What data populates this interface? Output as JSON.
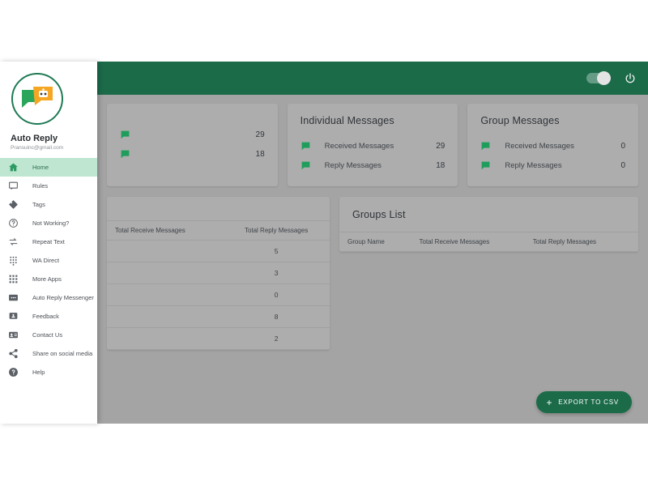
{
  "topbar": {
    "toggle": {
      "name": "service-toggle",
      "state": "on"
    },
    "power_icon": "power-icon"
  },
  "sidebar": {
    "logo_icon": "auto-reply-logo-icon",
    "brand_name": "Auto Reply",
    "account_email": "Pransuinc@gmail.com",
    "items": [
      {
        "label": "Home",
        "icon": "home-icon",
        "active": true
      },
      {
        "label": "Rules",
        "icon": "chat-bubble-icon",
        "active": false
      },
      {
        "label": "Tags",
        "icon": "tag-icon",
        "active": false
      },
      {
        "label": "Not Working?",
        "icon": "help-circle-icon",
        "active": false
      },
      {
        "label": "Repeat Text",
        "icon": "repeat-icon",
        "active": false
      },
      {
        "label": "WA Direct",
        "icon": "dialpad-icon",
        "active": false
      },
      {
        "label": "More Apps",
        "icon": "apps-grid-icon",
        "active": false
      },
      {
        "label": "Auto Reply Messenger",
        "icon": "messenger-icon",
        "active": false
      },
      {
        "label": "Feedback",
        "icon": "feedback-icon",
        "active": false
      },
      {
        "label": "Contact Us",
        "icon": "contact-card-icon",
        "active": false
      },
      {
        "label": "Share on social media",
        "icon": "share-icon",
        "active": false
      },
      {
        "label": "Help",
        "icon": "help-icon",
        "active": false
      }
    ]
  },
  "cards": [
    {
      "title": "",
      "rows": [
        {
          "icon": "message-icon",
          "label": "",
          "value": "29"
        },
        {
          "icon": "message-icon",
          "label": "",
          "value": "18"
        }
      ]
    },
    {
      "title": "Individual Messages",
      "rows": [
        {
          "icon": "message-icon",
          "label": "Received Messages",
          "value": "29"
        },
        {
          "icon": "message-icon",
          "label": "Reply Messages",
          "value": "18"
        }
      ]
    },
    {
      "title": "Group Messages",
      "rows": [
        {
          "icon": "message-icon",
          "label": "Received Messages",
          "value": "0"
        },
        {
          "icon": "message-icon",
          "label": "Reply Messages",
          "value": "0"
        }
      ]
    }
  ],
  "individual_table": {
    "title": "",
    "columns": [
      "Total Receive Messages",
      "Total Reply Messages"
    ],
    "rows": [
      [
        "",
        "5"
      ],
      [
        "",
        "3"
      ],
      [
        "",
        "0"
      ],
      [
        "",
        "8"
      ],
      [
        "",
        "2"
      ]
    ]
  },
  "groups_table": {
    "title": "Groups List",
    "columns": [
      "Group Name",
      "Total Receive Messages",
      "Total Reply Messages"
    ],
    "rows": []
  },
  "export_button": {
    "label": "EXPORT TO CSV",
    "icon": "plus-icon"
  },
  "colors": {
    "brand_green": "#1b6b49",
    "accent_green": "#1f9d5b",
    "active_nav_bg": "#bfe6d0",
    "overlay_gray": "#a4a4a4",
    "card_gray": "#adadad",
    "logo_orange": "#f5a623"
  }
}
